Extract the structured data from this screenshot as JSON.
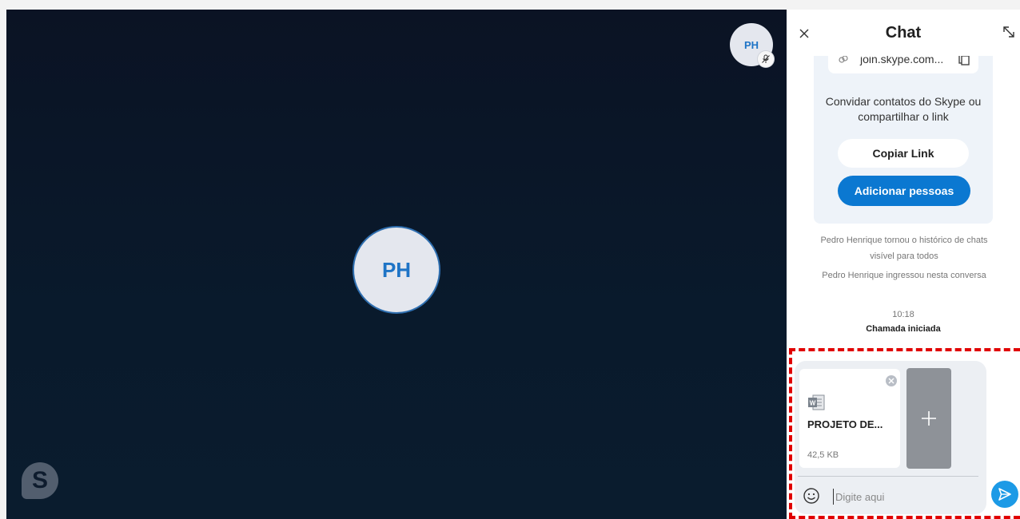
{
  "stage": {
    "center_avatar_initials": "PH",
    "mini_avatar_initials": "PH",
    "logo_letter": "S"
  },
  "chat": {
    "title": "Chat",
    "invite": {
      "link_text": "join.skype.com...",
      "text": "Convidar contatos do Skype ou compartilhar o link",
      "copy_link_label": "Copiar Link",
      "add_people_label": "Adicionar pessoas"
    },
    "messages": {
      "history_visible": "Pedro Henrique tornou o histórico de chats visível para todos",
      "joined": "Pedro Henrique ingressou nesta conversa",
      "time": "10:18",
      "call_started": "Chamada iniciada"
    },
    "composer": {
      "file_name": "PROJETO DE...",
      "file_size": "42,5 KB",
      "placeholder": "Digite aqui"
    }
  },
  "colors": {
    "accent": "#0b78d1",
    "send": "#1c9ae6",
    "highlight": "#e00000"
  },
  "icons": [
    "close-icon",
    "expand-icon",
    "link-icon",
    "copy-icon",
    "mute-icon",
    "word-file-icon",
    "remove-icon",
    "plus-icon",
    "emoji-icon",
    "send-icon",
    "skype-logo"
  ]
}
